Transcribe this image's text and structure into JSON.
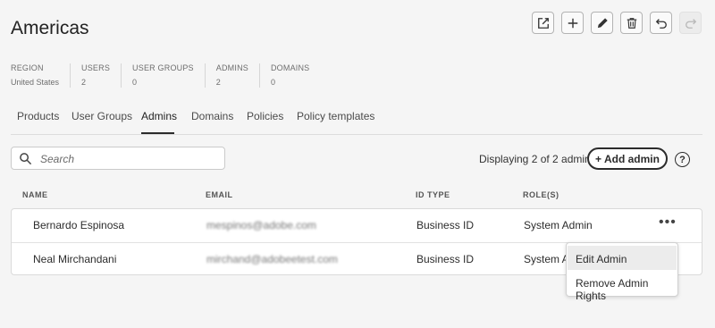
{
  "page": {
    "title": "Americas"
  },
  "toolbar": {
    "icons": [
      "open-external-icon",
      "plus-icon",
      "pencil-icon",
      "trash-icon",
      "undo-icon",
      "redo-icon"
    ]
  },
  "stats": [
    {
      "label": "REGION",
      "value": "United States"
    },
    {
      "label": "USERS",
      "value": "2"
    },
    {
      "label": "USER GROUPS",
      "value": "0"
    },
    {
      "label": "ADMINS",
      "value": "2"
    },
    {
      "label": "DOMAINS",
      "value": "0"
    }
  ],
  "tabs": [
    {
      "label": "Products"
    },
    {
      "label": "User Groups"
    },
    {
      "label": "Admins",
      "active": true
    },
    {
      "label": "Domains"
    },
    {
      "label": "Policies"
    },
    {
      "label": "Policy templates"
    }
  ],
  "search": {
    "placeholder": "Search",
    "value": ""
  },
  "summary": {
    "displaying": "Displaying 2 of 2 admins"
  },
  "add_admin": {
    "label": "+ Add admin"
  },
  "help": {
    "label": "?"
  },
  "table": {
    "columns": [
      "NAME",
      "EMAIL",
      "ID TYPE",
      "ROLE(S)"
    ],
    "rows": [
      {
        "name": "Bernardo Espinosa",
        "email": "mespinos@adobe.com",
        "id_type": "Business ID",
        "role": "System Admin",
        "more": "•••"
      },
      {
        "name": "Neal Mirchandani",
        "email": "mirchand@adobeetest.com",
        "id_type": "Business ID",
        "role": "System Ac"
      }
    ]
  },
  "context_menu": {
    "items": [
      "Edit Admin",
      "Remove Admin Rights"
    ]
  },
  "colors": {
    "accent": "#2c2c2c",
    "background": "#f5f5f5",
    "hover": "#ececec"
  }
}
